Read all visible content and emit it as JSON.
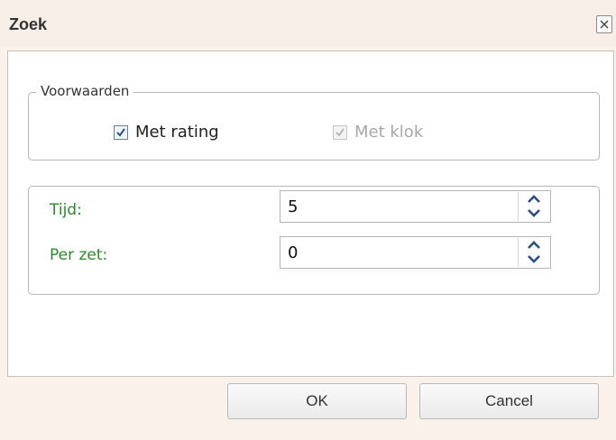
{
  "window": {
    "title": "Zoek",
    "close_icon": "close-icon"
  },
  "conditions": {
    "legend": "Voorwaarden",
    "with_rating": {
      "label": "Met rating",
      "checked": true,
      "enabled": true
    },
    "with_clock": {
      "label": "Met klok",
      "checked": true,
      "enabled": false
    }
  },
  "time": {
    "time_label": "Tijd:",
    "time_value": "5",
    "per_move_label": "Per zet:",
    "per_move_value": "0"
  },
  "buttons": {
    "ok": "OK",
    "cancel": "Cancel"
  },
  "colors": {
    "label_green": "#2a8a2a",
    "spinner_arrow": "#2b4f86",
    "checkbox_check": "#2b4f86"
  }
}
